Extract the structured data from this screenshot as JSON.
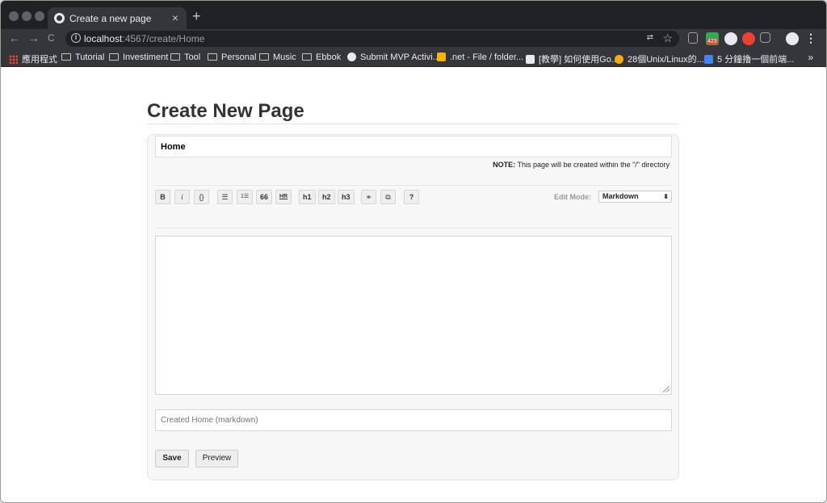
{
  "browser": {
    "tab_title": "Create a new page",
    "tab_close": "×",
    "new_tab": "+",
    "url_host": "localhost",
    "url_rest": ":4567/create/Home",
    "back": "←",
    "forward": "→",
    "reload": "C",
    "star": "☆",
    "menu": "⋮",
    "extension_badge": "423",
    "bookmarks": [
      {
        "label": "應用程式",
        "icon": "apps-grid-icon"
      },
      {
        "label": "Tutorial",
        "icon": "folder-icon"
      },
      {
        "label": "Investiment",
        "icon": "folder-icon"
      },
      {
        "label": "Tool",
        "icon": "folder-icon"
      },
      {
        "label": "Personal",
        "icon": "folder-icon"
      },
      {
        "label": "Music",
        "icon": "folder-icon"
      },
      {
        "label": "Ebbok",
        "icon": "folder-icon"
      },
      {
        "label": "Submit MVP Activi...",
        "icon": "globe-icon"
      },
      {
        "label": ".net - File / folder...",
        "icon": "site-icon"
      },
      {
        "label": "[教學] 如何使用Go...",
        "icon": "site-icon"
      },
      {
        "label": "28個Unix/Linux的...",
        "icon": "site-icon"
      },
      {
        "label": "5 分鐘擼一個前端...",
        "icon": "site-icon"
      }
    ],
    "bookmarks_more": "»"
  },
  "page": {
    "heading": "Create New Page",
    "title_value": "Home",
    "note_bold": "NOTE:",
    "note_text": " This page will be created within the \"/\" directory",
    "toolbar": {
      "bold": "B",
      "italic": "i",
      "code": "{}",
      "unordered_list": "☰",
      "ordered_list": "1☰",
      "quote": "66",
      "hr": "HR",
      "h1": "h1",
      "h2": "h2",
      "h3": "h3",
      "link": "⚭",
      "image": "⧉",
      "help": "?"
    },
    "edit_mode_label": "Edit Mode:",
    "edit_mode_value": "Markdown",
    "content_value": "",
    "commit_message_placeholder": "Created Home (markdown)",
    "save_label": "Save",
    "preview_label": "Preview"
  },
  "colors": {
    "chrome_dark": "#202124",
    "chrome_bar": "#35363a",
    "panel_bg": "#f7f7f7",
    "heading_text": "#333333"
  }
}
